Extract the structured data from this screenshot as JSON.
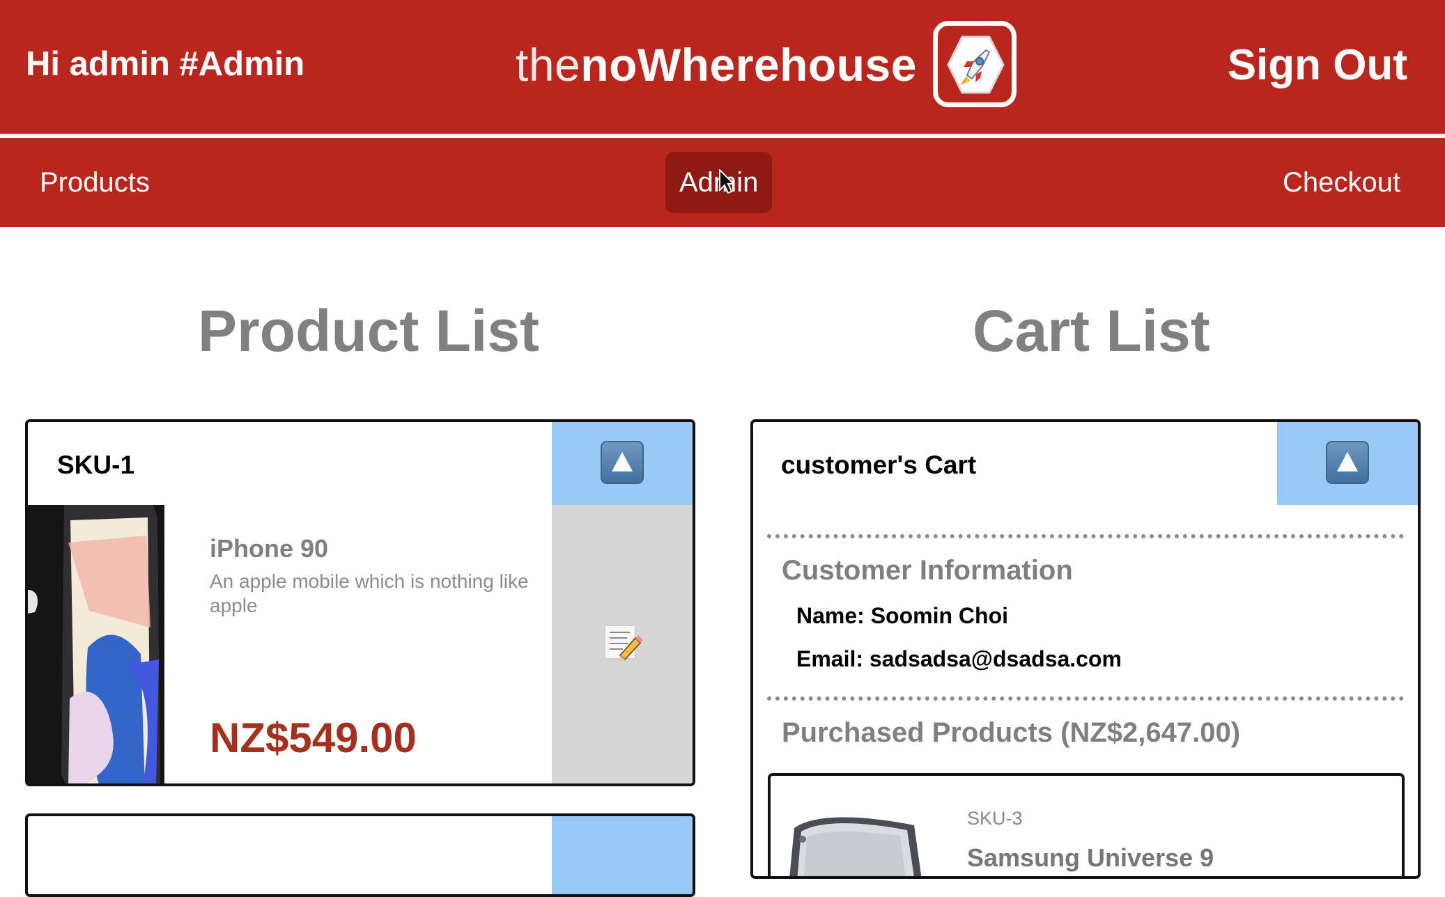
{
  "header": {
    "greeting": "Hi admin #Admin",
    "brand_light": "the",
    "brand_bold": "noWherehouse",
    "logo_icon": "rocket-icon",
    "sign_out": "Sign Out",
    "background_color": "#b9261d"
  },
  "nav": {
    "items": [
      {
        "label": "Products",
        "active": false
      },
      {
        "label": "Admin",
        "active": true
      },
      {
        "label": "Checkout",
        "active": false
      }
    ]
  },
  "product_section": {
    "title": "Product List",
    "products": [
      {
        "sku": "SKU-1",
        "name": "iPhone 90",
        "description": "An apple mobile which is nothing like apple",
        "price": "NZ$549.00",
        "collapse_icon": "triangle-up-icon",
        "edit_icon": "memo-pencil-icon"
      }
    ]
  },
  "cart_section": {
    "title": "Cart List",
    "cart": {
      "title": "customer's Cart",
      "customer_information_heading": "Customer Information",
      "name_line": "Name: Soomin Choi",
      "email_line": "Email: sadsadsa@dsadsa.com",
      "purchased_heading": "Purchased Products (NZ$2,647.00)",
      "items": [
        {
          "sku": "SKU-3",
          "name": "Samsung Universe 9"
        }
      ]
    }
  },
  "colors": {
    "accent_red": "#b9261d",
    "active_nav": "#8f1a14",
    "panel_blue": "#99c9f6",
    "price_red": "#a4301e"
  }
}
